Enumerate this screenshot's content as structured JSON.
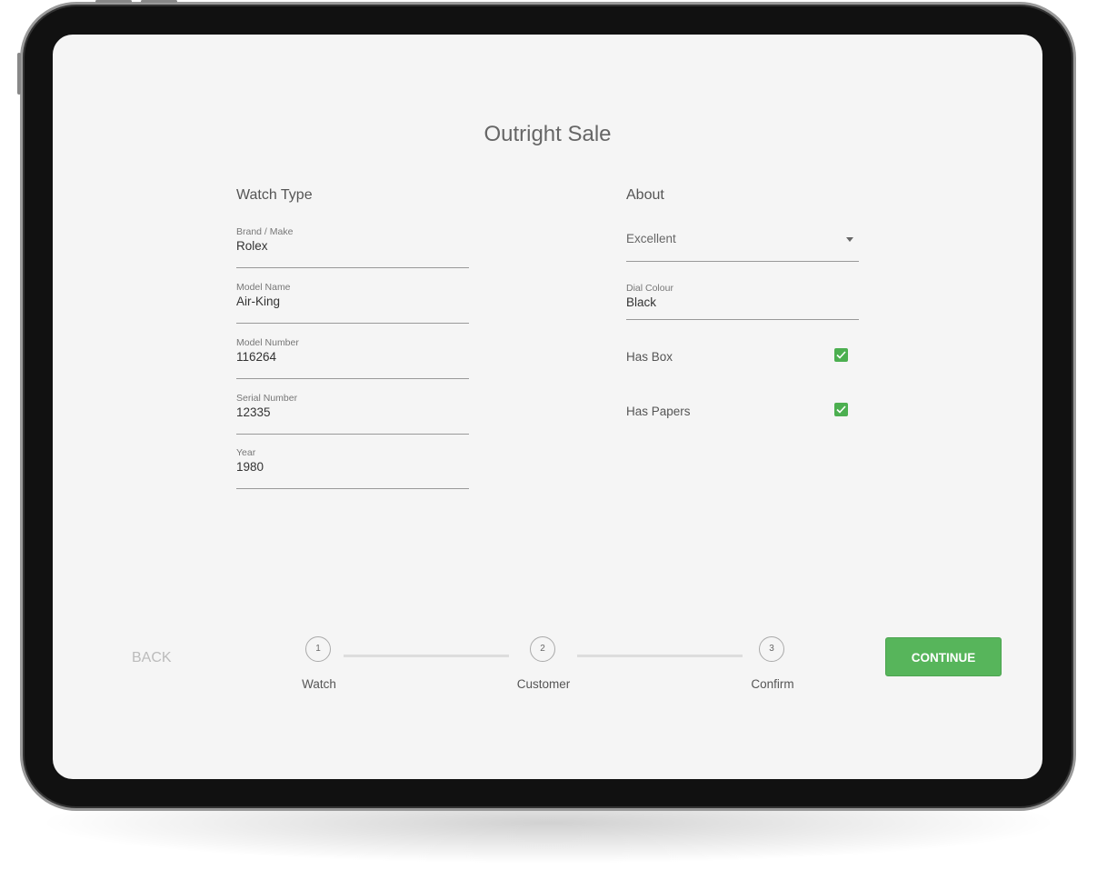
{
  "page": {
    "title": "Outright Sale"
  },
  "watch_type": {
    "heading": "Watch Type",
    "fields": [
      {
        "label": "Brand / Make",
        "value": "Rolex"
      },
      {
        "label": "Model Name",
        "value": "Air-King"
      },
      {
        "label": "Model Number",
        "value": "116264"
      },
      {
        "label": "Serial Number",
        "value": "12335"
      },
      {
        "label": "Year",
        "value": "1980"
      }
    ]
  },
  "about": {
    "heading": "About",
    "condition": "Excellent",
    "dial": {
      "label": "Dial Colour",
      "value": "Black"
    },
    "has_box": {
      "label": "Has Box",
      "checked": true
    },
    "has_papers": {
      "label": "Has Papers",
      "checked": true
    }
  },
  "stepper": {
    "steps": [
      {
        "num": "1",
        "label": "Watch"
      },
      {
        "num": "2",
        "label": "Customer"
      },
      {
        "num": "3",
        "label": "Confirm"
      }
    ]
  },
  "actions": {
    "back": "BACK",
    "continue": "CONTINUE"
  },
  "colors": {
    "accent": "#57b55b"
  }
}
